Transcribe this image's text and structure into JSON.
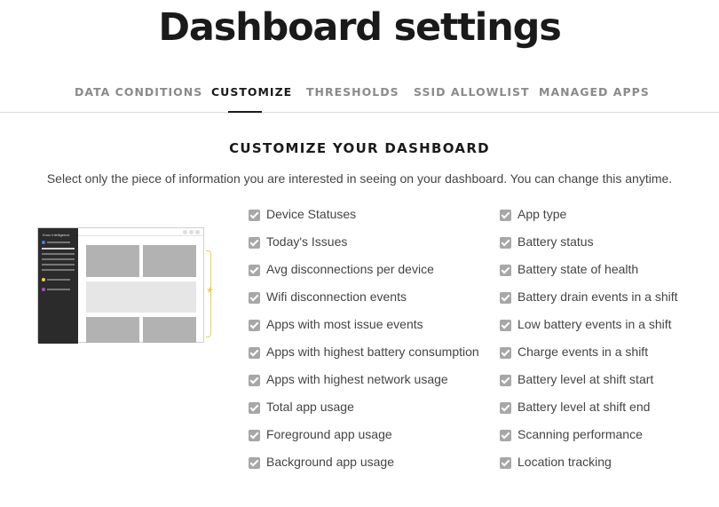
{
  "page": {
    "title": "Dashboard settings"
  },
  "tabs": [
    {
      "label": "DATA CONDITIONS",
      "active": false
    },
    {
      "label": "CUSTOMIZE",
      "active": true
    },
    {
      "label": "THRESHOLDS",
      "active": false
    },
    {
      "label": "SSID ALLOWLIST",
      "active": false
    },
    {
      "label": "MANAGED APPS",
      "active": false
    }
  ],
  "section": {
    "title": "CUSTOMIZE YOUR DASHBOARD",
    "description": "Select only the piece of information you are interested in seeing on your dashboard. You can change this anytime."
  },
  "preview": {
    "brand": "Knox Intelligence",
    "accent_yellow": "#f1cf4c",
    "accent_blue": "#4a7fd6",
    "accent_purple": "#b04ad6"
  },
  "options": {
    "left": [
      {
        "label": "Device Statuses",
        "checked": true
      },
      {
        "label": "Today's Issues",
        "checked": true
      },
      {
        "label": "Avg disconnections per device",
        "checked": true
      },
      {
        "label": "Wifi disconnection events",
        "checked": true
      },
      {
        "label": "Apps with most issue events",
        "checked": true
      },
      {
        "label": "Apps with highest battery consumption",
        "checked": true
      },
      {
        "label": "Apps with highest network usage",
        "checked": true
      },
      {
        "label": "Total app usage",
        "checked": true
      },
      {
        "label": "Foreground app usage",
        "checked": true
      },
      {
        "label": "Background app usage",
        "checked": true
      }
    ],
    "right": [
      {
        "label": "App type",
        "checked": true
      },
      {
        "label": "Battery status",
        "checked": true
      },
      {
        "label": "Battery state of health",
        "checked": true
      },
      {
        "label": "Battery drain events in a shift",
        "checked": true
      },
      {
        "label": "Low battery events in a shift",
        "checked": true
      },
      {
        "label": "Charge events in a shift",
        "checked": true
      },
      {
        "label": "Battery level at shift start",
        "checked": true
      },
      {
        "label": "Battery level at shift end",
        "checked": true
      },
      {
        "label": "Scanning performance",
        "checked": true
      },
      {
        "label": "Location tracking",
        "checked": true
      }
    ]
  }
}
